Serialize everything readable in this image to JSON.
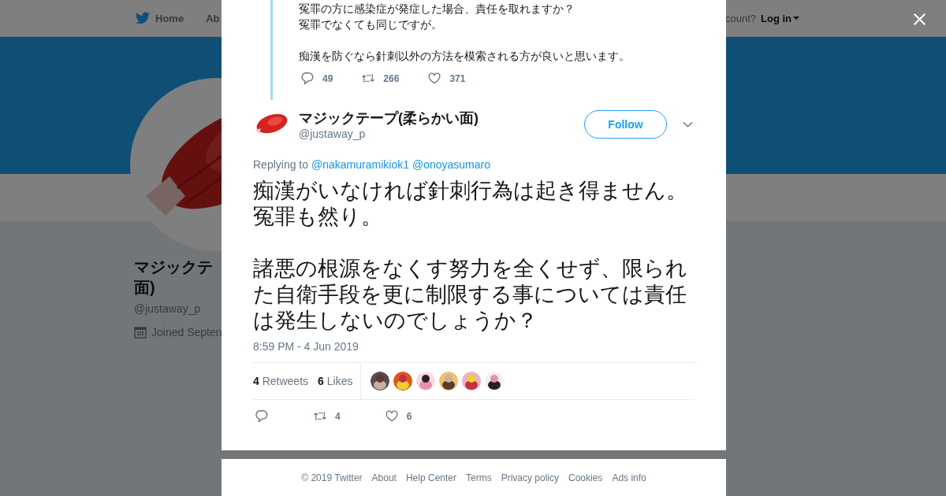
{
  "nav": {
    "items": [
      {
        "label": "Home"
      },
      {
        "label": "Ab"
      }
    ],
    "account_prompt": "count?",
    "login": "Log in"
  },
  "profile": {
    "name_lines": [
      "マジックテ",
      "面)"
    ],
    "handle": "@justaway_p",
    "joined": "Joined Septen"
  },
  "modal": {
    "previous_tweet": {
      "paragraphs": [
        [
          "冤罪の方に感染症が発症した場合、責任を取れますか？",
          "冤罪でなくても同じですが。"
        ],
        [
          "痴漢を防ぐなら針刺以外の方法を模索される方が良いと思います。"
        ]
      ],
      "replies": "49",
      "retweets": "266",
      "likes": "371"
    },
    "tweet": {
      "name": "マジックテープ(柔らかい面)",
      "handle": "@justaway_p",
      "follow": "Follow",
      "replying_label": "Replying to",
      "replying_to": [
        "@nakamuramikiok1",
        "@onoyasumaro"
      ],
      "paragraphs": [
        [
          "痴漢がいなければ針刺行為は起き得ません。",
          "冤罪も然り。"
        ],
        [
          "諸悪の根源をなくす努力を全くせず、限られた自衛手段を更に制限する事については責任は発生しないのでしょうか？"
        ]
      ],
      "timestamp": "8:59 PM - 4 Jun 2019",
      "retweet_count": "4",
      "retweet_label": "Retweets",
      "like_count": "6",
      "like_label": "Likes",
      "liked_by": [
        {
          "kind": "picture"
        },
        {
          "kind": "picture"
        },
        {
          "kind": "picture"
        },
        {
          "kind": "picture"
        },
        {
          "kind": "picture"
        },
        {
          "kind": "picture"
        }
      ],
      "retweets": "4",
      "likes": "6"
    }
  },
  "footer": [
    "© 2019 Twitter",
    "About",
    "Help Center",
    "Terms",
    "Privacy policy",
    "Cookies",
    "Ads info"
  ]
}
